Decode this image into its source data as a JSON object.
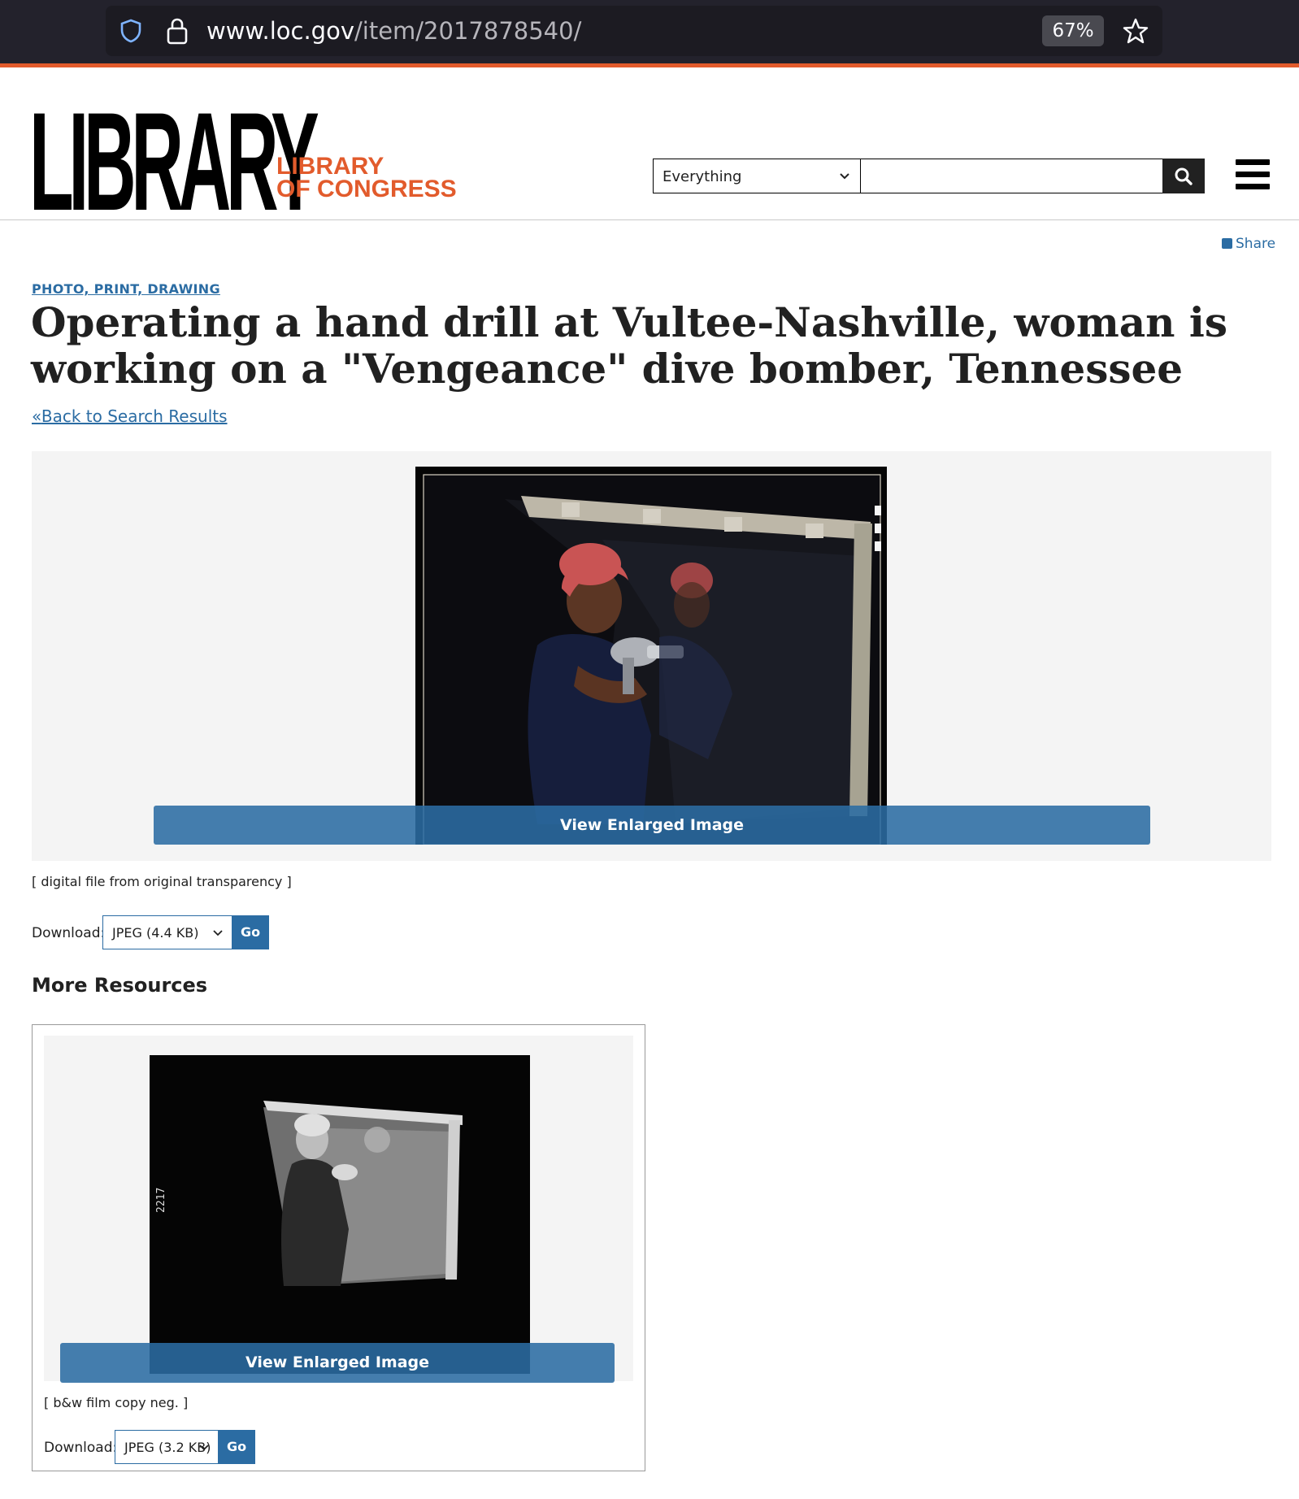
{
  "browser": {
    "url_host": "www.loc.gov",
    "url_path": "/item/2017878540/",
    "zoom": "67%"
  },
  "header": {
    "logo_big": "LIBRARY",
    "logo_small_line1": "LIBRARY",
    "logo_small_line2": "OF CONGRESS",
    "search_scope": "Everything",
    "search_placeholder": ""
  },
  "item": {
    "share_label": "Share",
    "category": "PHOTO, PRINT, DRAWING",
    "title": "Operating a hand drill at Vultee-Nashville, woman is working on a \"Vengeance\" dive bomber, Tennessee",
    "back_link": "Back to Search Results",
    "back_icon": "«"
  },
  "primary_resource": {
    "enlarge_label": "View Enlarged Image",
    "caption": "[ digital file from original transparency ]",
    "download_label": "Download:",
    "download_option": "JPEG (4.4 KB)",
    "go_label": "Go"
  },
  "more_resources": {
    "heading": "More Resources",
    "items": [
      {
        "enlarge_label": "View Enlarged Image",
        "caption": "[ b&w film copy neg. ]",
        "download_label": "Download:",
        "download_option": "JPEG (3.2 KB)",
        "go_label": "Go",
        "neg_number": "2217"
      }
    ]
  },
  "colors": {
    "accent_orange": "#e25b2c",
    "link_blue": "#2b6ca3",
    "chrome_dark": "#23222c"
  },
  "icons": [
    "shield-icon",
    "lock-icon",
    "star-icon",
    "chevron-down-icon",
    "search-icon",
    "hamburger-menu-icon",
    "share-icon"
  ]
}
